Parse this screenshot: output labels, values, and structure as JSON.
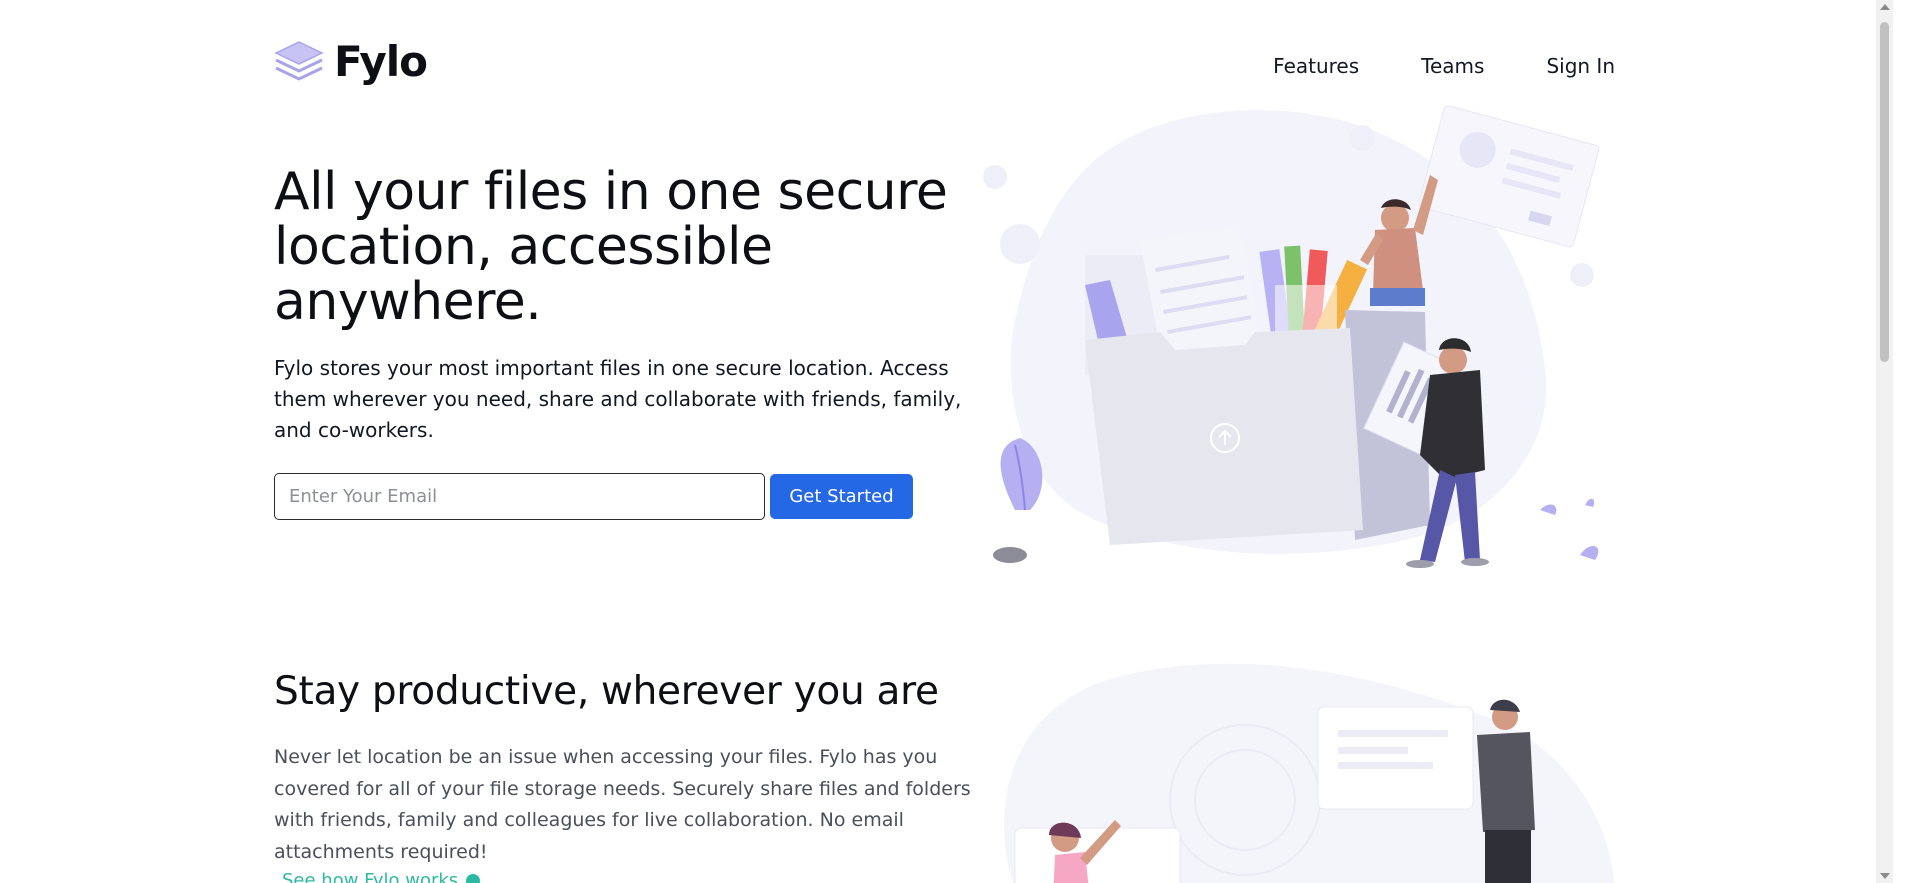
{
  "brand": {
    "name": "Fylo",
    "icon": "stacked-layers-icon",
    "accent": "#2468e6",
    "link_color": "#2bb9a0"
  },
  "nav": {
    "items": [
      {
        "label": "Features"
      },
      {
        "label": "Teams"
      },
      {
        "label": "Sign In"
      }
    ]
  },
  "hero": {
    "title": "All your files in one secure location, accessible anywhere.",
    "text": "Fylo stores your most important files in one secure location. Access them wherever you need, share and collaborate with friends, family, and co-workers.",
    "email_placeholder": "Enter Your Email",
    "email_value": "",
    "cta_label": "Get Started",
    "illustration": "file-collaboration-illustration"
  },
  "productive": {
    "title": "Stay productive, wherever you are",
    "text": "Never let location be an issue when accessing your files. Fylo has you covered for all of your file storage needs. Securely share files and folders with friends, family and colleagues for live collaboration. No email attachments required!",
    "link_label": "See how Fylo works",
    "illustration": "team-chat-illustration"
  }
}
